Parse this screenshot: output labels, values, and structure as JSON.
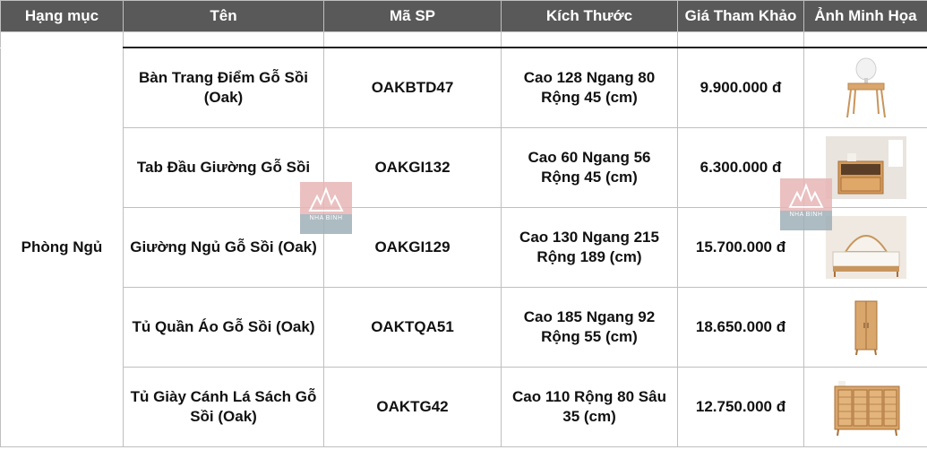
{
  "headers": [
    "Hạng mục",
    "Tên",
    "Mã SP",
    "Kích Thước",
    "Giá Tham Khảo",
    "Ảnh Minh Họa"
  ],
  "category": "Phòng Ngủ",
  "rows": [
    {
      "name": "Bàn Trang Điểm Gỗ Sồi (Oak)",
      "code": "OAKBTD47",
      "size": "Cao 128 Ngang 80 Rộng 45 (cm)",
      "price": "9.900.000 đ",
      "image": "vanity-table-image"
    },
    {
      "name": "Tab Đầu Giường Gỗ Sồi",
      "code": "OAKGI132",
      "size": "Cao 60 Ngang 56 Rộng 45 (cm)",
      "price": "6.300.000 đ",
      "image": "nightstand-image"
    },
    {
      "name": "Giường Ngủ Gỗ Sồi (Oak)",
      "code": "OAKGI129",
      "size": "Cao 130 Ngang 215 Rộng 189 (cm)",
      "price": "15.700.000 đ",
      "image": "bed-image"
    },
    {
      "name": "Tủ Quần Áo Gỗ Sồi (Oak)",
      "code": "OAKTQA51",
      "size": "Cao 185 Ngang 92 Rộng 55 (cm)",
      "price": "18.650.000 đ",
      "image": "wardrobe-image"
    },
    {
      "name": "Tủ Giày Cánh Lá Sách Gỗ Sồi (Oak)",
      "code": "OAKTG42",
      "size": "Cao 110 Rộng 80 Sâu 35 (cm)",
      "price": "12.750.000 đ",
      "image": "shoe-cabinet-image"
    }
  ],
  "watermark": "NHA BINH",
  "colors": {
    "header_bg": "#595959",
    "header_text": "#ffffff",
    "grid": "#bfbfbf",
    "wood": "#d9a66b"
  }
}
